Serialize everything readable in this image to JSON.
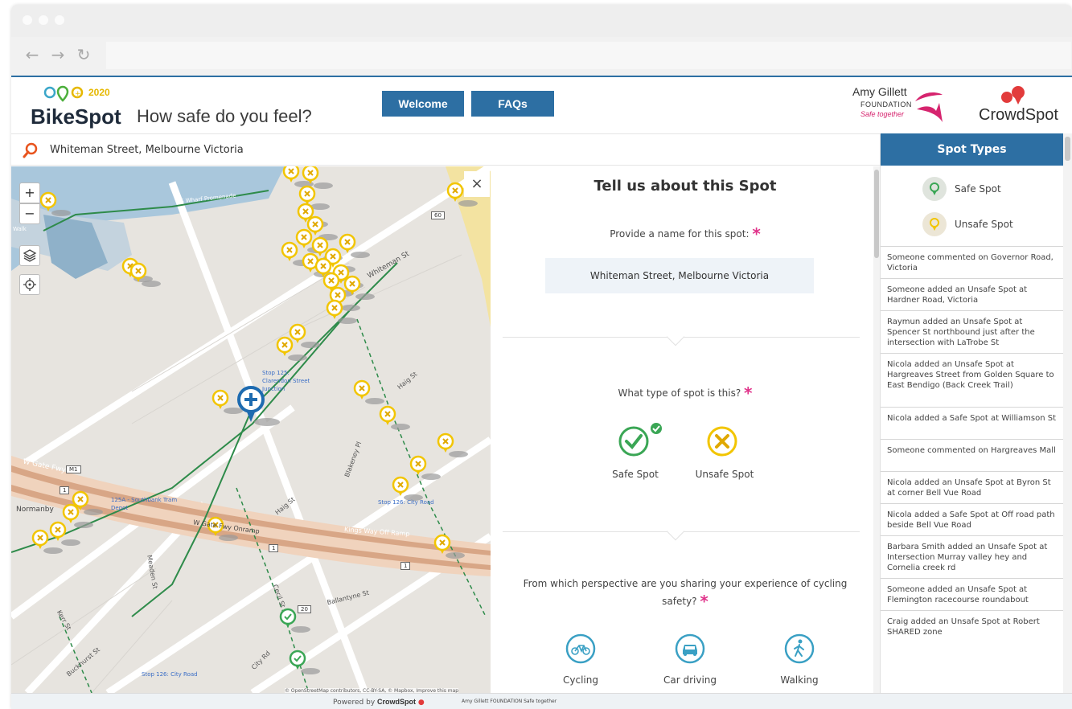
{
  "browser": {
    "nav": {
      "back": "←",
      "forward": "→",
      "reload": "↻"
    }
  },
  "header": {
    "logo_year": "2020",
    "logo_word_a": "Bike",
    "logo_word_b": "Spot",
    "tagline": "How safe do you feel?",
    "welcome_label": "Welcome",
    "faqs_label": "FAQs",
    "partner_name": "Amy Gillett",
    "partner_sub": "FOUNDATION",
    "partner_slogan": "Safe together",
    "crowd_brand": "CrowdSpot",
    "accent_color": "#2d6fa3",
    "partner_color": "#d6246e"
  },
  "search": {
    "value": "Whiteman Street, Melbourne Victoria",
    "icon": "search-icon"
  },
  "map": {
    "zoom_in": "+",
    "zoom_out": "−",
    "close": "×",
    "labels": {
      "wharf": "S Wharf Promenade",
      "walk": "Walk",
      "whiteman": "Whiteman St",
      "haig1": "Haig St",
      "haig2": "Haig St",
      "wgate": "W Gate Fwy",
      "m1": "M1",
      "norman": "Normanby",
      "wgate_onramp": "W Gate Fwy Onramp",
      "kingsway": "Kings Way Off Ramp",
      "blakeney": "Blakeney Pl",
      "meaden": "Meaden St",
      "ballantyne": "Ballantyne St",
      "cecil": "Cecil St",
      "cityrd": "City Rd",
      "kerr": "Kerr St",
      "buckhurst": "Buckhurst St",
      "stop125": "Stop 125: Clarendon Street Junction",
      "stop126a": "Stop 126: City Road",
      "stop126b": "Stop 126: City Road",
      "depot": "125A - Southbank Tram Depot",
      "shield60": "60",
      "shield1a": "1",
      "shield1b": "1",
      "shield1c": "1",
      "shield20": "20"
    },
    "attribution": "© OpenStreetMap contributors, CC-BY-SA, © Mapbox, Improve this map"
  },
  "form": {
    "title": "Tell us about this Spot",
    "name_label": "Provide a name for this spot:",
    "name_value": "Whiteman Street, Melbourne Victoria",
    "type_label": "What type of spot is this?",
    "safe_label": "Safe Spot",
    "unsafe_label": "Unsafe Spot",
    "selected_type": "Safe Spot",
    "perspective_label": "From which perspective are you sharing your experience of cycling safety?",
    "required_mark": "*",
    "perspectives": [
      "Cycling",
      "Car driving",
      "Walking"
    ]
  },
  "sidebar": {
    "title": "Spot Types",
    "types": [
      "Safe Spot",
      "Unsafe Spot"
    ],
    "feed": [
      "Someone commented on Governor Road, Victoria",
      "Someone added an Unsafe Spot at Hardner Road, Victoria",
      "Raymun added an Unsafe Spot at Spencer St northbound just after the intersection with LaTrobe St",
      "Nicola added an Unsafe Spot at Hargreaves Street from Golden Square to East Bendigo (Back Creek Trail)",
      "Nicola added a Safe Spot at Williamson St",
      "Someone commented on Hargreaves Mall",
      "Nicola added an Unsafe Spot at Byron St at corner Bell Vue Road",
      "Nicola added a Safe Spot at Off road path beside Bell Vue Road",
      "Barbara Smith added an Unsafe Spot at Intersection Murray valley hey and Cornelia creek rd",
      "Someone added an Unsafe Spot at Flemington racecourse roundabout",
      "Craig added an Unsafe Spot at Robert SHARED zone"
    ]
  },
  "footer": {
    "powered_by": "Powered by",
    "brand": "CrowdSpot",
    "partner": "Amy Gillett FOUNDATION Safe together"
  }
}
